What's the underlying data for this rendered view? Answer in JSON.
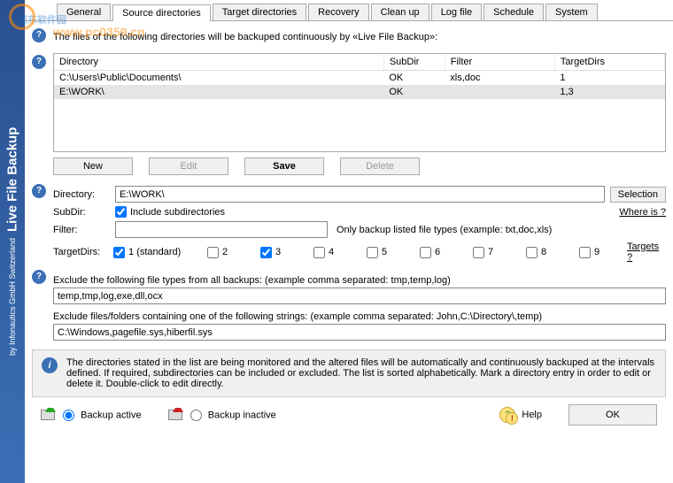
{
  "app": {
    "title": "Live File Backup",
    "byline": "by Infonautics GmbH Switzerland"
  },
  "watermark": {
    "l1": "河东软件园",
    "l2": "www.pc0359.cn"
  },
  "tabs": [
    "General",
    "Source directories",
    "Target directories",
    "Recovery",
    "Clean up",
    "Log file",
    "Schedule",
    "System"
  ],
  "active_tab": 1,
  "intro": "The files of the following directories will be backuped continuously by «Live File Backup»:",
  "table": {
    "headers": [
      "Directory",
      "SubDir",
      "Filter",
      "TargetDirs"
    ],
    "rows": [
      {
        "dir": "C:\\Users\\Public\\Documents\\",
        "subdir": "OK",
        "filter": "xls,doc",
        "targets": "1"
      },
      {
        "dir": "E:\\WORK\\",
        "subdir": "OK",
        "filter": "",
        "targets": "1,3"
      }
    ],
    "selected": 1
  },
  "buttons": {
    "new": "New",
    "edit": "Edit",
    "save": "Save",
    "del": "Delete"
  },
  "form": {
    "dir_label": "Directory:",
    "dir_value": "E:\\WORK\\",
    "selection": "Selection",
    "subdir_label": "SubDir:",
    "subdir_check": true,
    "subdir_text": "Include subdirectories",
    "whereis": "Where is ?",
    "filter_label": "Filter:",
    "filter_value": "",
    "filter_hint": "Only backup listed file types   (example: txt,doc,xls)",
    "targets_label": "TargetDirs:",
    "targets_link": "Targets ?",
    "targets": [
      {
        "n": "1  (standard)",
        "c": true
      },
      {
        "n": "2",
        "c": false
      },
      {
        "n": "3",
        "c": true
      },
      {
        "n": "4",
        "c": false
      },
      {
        "n": "5",
        "c": false
      },
      {
        "n": "6",
        "c": false
      },
      {
        "n": "7",
        "c": false
      },
      {
        "n": "8",
        "c": false
      },
      {
        "n": "9",
        "c": false
      }
    ]
  },
  "exclude1": {
    "label": "Exclude the following file types from all backups:   (example comma separated: tmp,temp,log)",
    "value": "temp,tmp,log,exe,dll,ocx"
  },
  "exclude2": {
    "label": "Exclude files/folders containing one of the following strings:   (example comma separated: John,C:\\Directory\\,temp)",
    "value": "C:\\Windows,pagefile.sys,hiberfil.sys"
  },
  "info": "The directories stated in the list are being monitored and the altered files will be automatically and continuously backuped at the intervals defined. If required, subdirectories can be included or excluded. The list is sorted alphabetically. Mark a directory entry in order to edit or delete it. Double-click to edit directly.",
  "bottom": {
    "active": "Backup active",
    "inactive": "Backup inactive",
    "help": "Help",
    "ok": "OK",
    "radio_value": "active"
  }
}
